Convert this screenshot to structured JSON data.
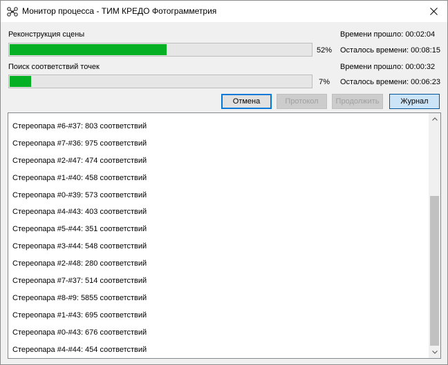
{
  "window": {
    "title": "Монитор процесса -  ТИМ КРЕДО Фотограмметрия",
    "icon": "drone-icon",
    "close": "close-icon"
  },
  "tasks": [
    {
      "label": "Реконструкция сцены",
      "progress": 52,
      "percent_text": "52%",
      "elapsed": "Времени прошло: 00:02:04",
      "remaining": "Осталось времени: 00:08:15"
    },
    {
      "label": "Поиск соответствий точек",
      "progress": 7,
      "percent_text": "7%",
      "elapsed": "Времени прошло: 00:00:32",
      "remaining": "Осталось времени: 00:06:23"
    }
  ],
  "buttons": {
    "cancel": "Отмена",
    "report": "Протокол",
    "continue": "Продолжить",
    "journal": "Журнал"
  },
  "log": [
    "Стереопара #6-#37: 803 соответствий",
    "Стереопара #7-#36: 975 соответствий",
    "Стереопара #2-#47: 474 соответствий",
    "Стереопара #1-#40: 458 соответствий",
    "Стереопара #0-#39: 573 соответствий",
    "Стереопара #4-#43: 403 соответствий",
    "Стереопара #5-#44: 351 соответствий",
    "Стереопара #3-#44: 548 соответствий",
    "Стереопара #2-#48: 280 соответствий",
    "Стереопара #7-#37: 514 соответствий",
    "Стереопара #8-#9: 5855 соответствий",
    "Стереопара #1-#43: 695 соответствий",
    "Стереопара #0-#43: 676 соответствий",
    "Стереопара #4-#44: 454 соответствий"
  ],
  "colors": {
    "progress_fill": "#06b025",
    "accent": "#0078d7"
  }
}
